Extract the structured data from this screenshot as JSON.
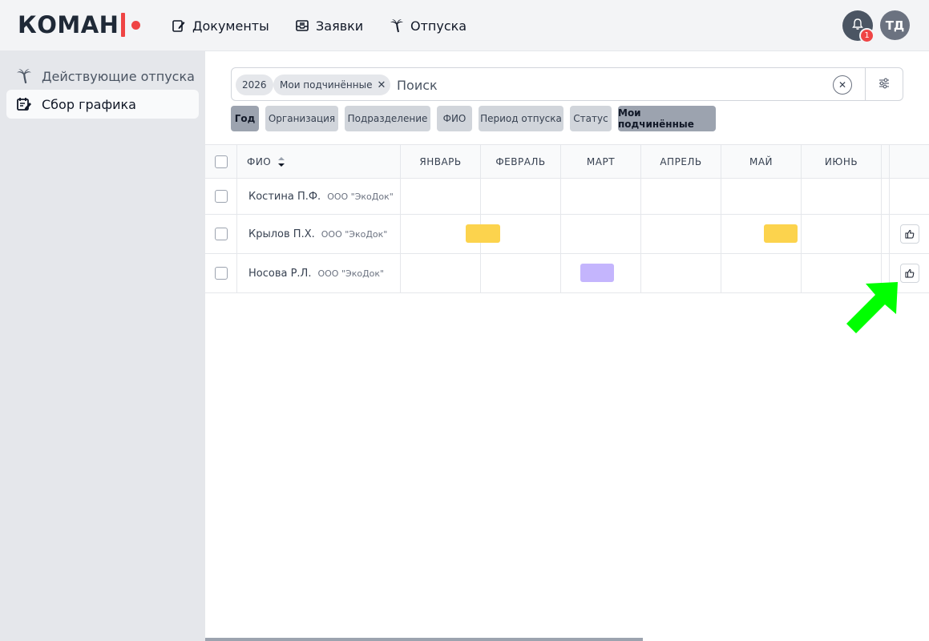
{
  "logo": {
    "text": "КОМАН"
  },
  "header": {
    "nav": [
      {
        "label": "Документы",
        "icon": "document-edit-icon"
      },
      {
        "label": "Заявки",
        "icon": "inbox-icon"
      },
      {
        "label": "Отпуска",
        "icon": "palm-tree-icon"
      }
    ],
    "notifications_count": "1",
    "user_initials": "ТД"
  },
  "sidebar": {
    "items": [
      {
        "label": "Действующие отпуска",
        "icon": "palm-tree-icon",
        "active": false
      },
      {
        "label": "Сбор графика",
        "icon": "calendar-edit-icon",
        "active": true
      }
    ]
  },
  "search": {
    "chips": [
      {
        "label": "2026"
      },
      {
        "label": "Мои подчинённые"
      }
    ],
    "placeholder": "Поиск"
  },
  "filters": [
    {
      "label": "Год",
      "active": true
    },
    {
      "label": "Организация",
      "active": false
    },
    {
      "label": "Подразделение",
      "active": false
    },
    {
      "label": "ФИО",
      "active": false
    },
    {
      "label": "Период отпуска",
      "active": false
    },
    {
      "label": "Статус",
      "active": false
    },
    {
      "label": "Мои подчинённые",
      "active": true
    }
  ],
  "table": {
    "columns": [
      "ФИО",
      "ЯНВАРЬ",
      "ФЕВРАЛЬ",
      "МАРТ",
      "АПРЕЛЬ",
      "МАЙ",
      "ИЮНЬ"
    ],
    "rows": [
      {
        "name": "Костина П.Ф.",
        "org": "ООО \"ЭкоДок\"",
        "has_like": false
      },
      {
        "name": "Крылов П.Х.",
        "org": "ООО \"ЭкоДок\"",
        "has_like": true
      },
      {
        "name": "Носова Р.Л.",
        "org": "ООО \"ЭкоДок\"",
        "has_like": true
      }
    ]
  },
  "colors": {
    "bar_yellow": "#fcd34d",
    "bar_purple": "#c4b5fd",
    "accent_red": "#ef4444",
    "arrow_green": "#00ff00"
  }
}
